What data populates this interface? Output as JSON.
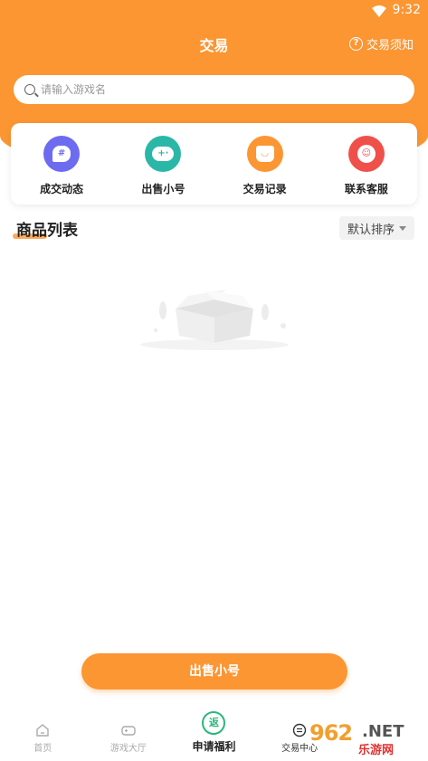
{
  "status_bar": {
    "time": "9:32"
  },
  "header": {
    "title": "交易",
    "notice_label": "交易须知"
  },
  "search": {
    "placeholder": "请输入游戏名"
  },
  "quick_actions": [
    {
      "label": "成交动态",
      "icon": "hash-chat-icon",
      "color": "#6D6BEF"
    },
    {
      "label": "出售小号",
      "icon": "gamepad-icon",
      "color": "#2BB7A7"
    },
    {
      "label": "交易记录",
      "icon": "shopping-bag-icon",
      "color": "#FB9633"
    },
    {
      "label": "联系客服",
      "icon": "headset-icon",
      "color": "#F0504A"
    }
  ],
  "product_list": {
    "title": "商品列表",
    "sort_label": "默认排序"
  },
  "sell_button": {
    "label": "出售小号"
  },
  "tabbar": {
    "items": [
      {
        "label": "首页",
        "icon": "home-icon"
      },
      {
        "label": "游戏大厅",
        "icon": "gamepad-icon"
      },
      {
        "label": "申请福利",
        "icon": "rebate-icon",
        "icon_text": "返"
      },
      {
        "label": "交易中心",
        "icon": "trade-icon"
      }
    ]
  },
  "watermark": {
    "number": "962",
    "suffix": ".NET",
    "site": "乐游网"
  },
  "colors": {
    "accent": "#FB9633",
    "rebate": "#2BB77A"
  }
}
